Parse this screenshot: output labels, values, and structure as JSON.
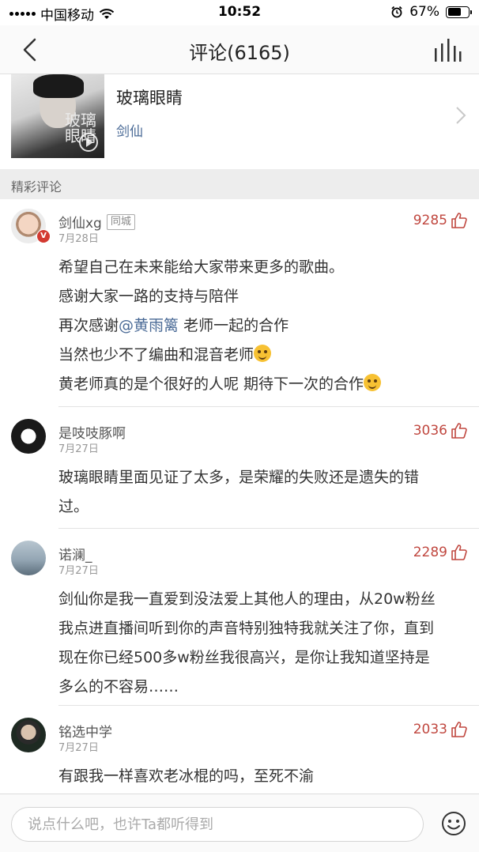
{
  "status_bar": {
    "carrier": "中国移动",
    "time": "10:52",
    "battery_text": "67%",
    "battery_level": 0.67
  },
  "nav": {
    "title": "评论(6165)"
  },
  "song": {
    "title": "玻璃眼睛",
    "artist": "剑仙",
    "cover_text": "玻璃眼睛"
  },
  "section_label": "精彩评论",
  "comments": [
    {
      "user": "剑仙xg",
      "tag": "同城",
      "date": "7月28日",
      "likes": "9285",
      "lines": {
        "l1": "希望自己在未来能给大家带来更多的歌曲。",
        "l2": "感谢大家一路的支持与陪伴",
        "l3_before": "再次感谢",
        "l3_mention": "@黄雨篱",
        "l3_after": " 老师一起的合作",
        "l4": "当然也少不了编曲和混音老师",
        "l5": "黄老师真的是个很好的人呢 期待下一次的合作"
      }
    },
    {
      "user": "是吱吱豚啊",
      "date": "7月27日",
      "likes": "3036",
      "lines": {
        "l1": "玻璃眼睛里面见证了太多，是荣耀的失败还是遗失的错",
        "l2": "过。"
      }
    },
    {
      "user": "诺澜_",
      "date": "7月27日",
      "likes": "2289",
      "lines": {
        "l1": "剑仙你是我一直爱到没法爱上其他人的理由，从20w粉丝",
        "l2": "我点进直播间听到你的声音特别独特我就关注了你，直到",
        "l3": "现在你已经500多w粉丝我很高兴，是你让我知道坚持是",
        "l4": "多么的不容易……"
      }
    },
    {
      "user": "铭选中学",
      "date": "7月27日",
      "likes": "2033",
      "lines": {
        "l1": "有跟我一样喜欢老冰棍的吗，至死不渝"
      }
    }
  ],
  "input": {
    "placeholder": "说点什么吧，也许Ta都听得到"
  },
  "icons": {
    "back": "chevron-left-icon",
    "chart": "chart-bars-icon",
    "like": "thumbs-up-icon",
    "emoji": "smiley-icon"
  },
  "colors": {
    "likes": "#c0473f",
    "mention": "#4a6a96",
    "badge": "#d33a31"
  }
}
